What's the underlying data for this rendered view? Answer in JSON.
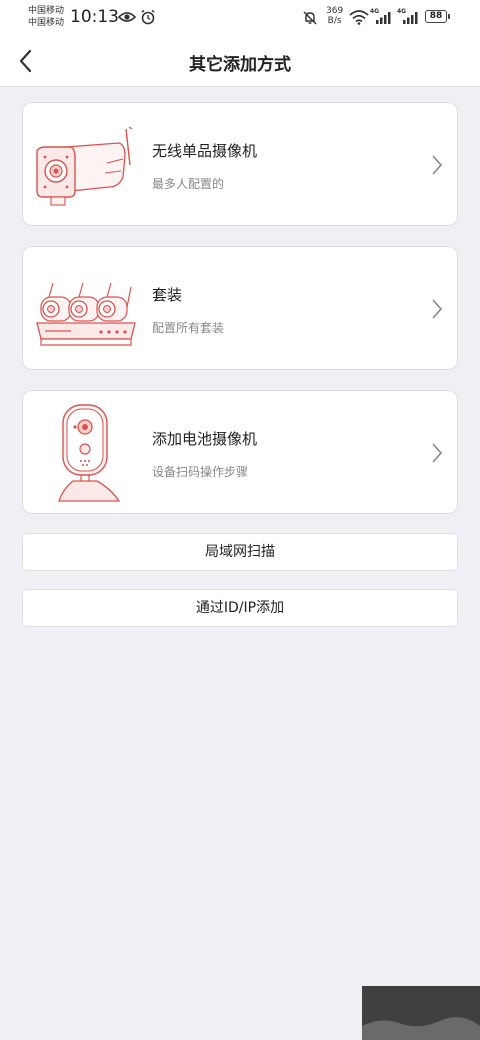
{
  "status_bar": {
    "carrier_1": "中国移动",
    "carrier_2": "中国移动",
    "time": "10:13",
    "speed_value": "369",
    "speed_unit": "B/s",
    "network_1": "4G",
    "network_2": "4G",
    "battery": "88"
  },
  "header": {
    "title": "其它添加方式"
  },
  "options": [
    {
      "title": "无线单品摄像机",
      "subtitle": "最多人配置的"
    },
    {
      "title": "套装",
      "subtitle": "配置所有套装"
    },
    {
      "title": "添加电池摄像机",
      "subtitle": "设备扫码操作步骤"
    }
  ],
  "buttons": {
    "lan_scan": "局域网扫描",
    "add_by_id": "通过ID/IP添加"
  },
  "colors": {
    "accent_illustration": "#d9534f",
    "background": "#f0f0f4"
  }
}
